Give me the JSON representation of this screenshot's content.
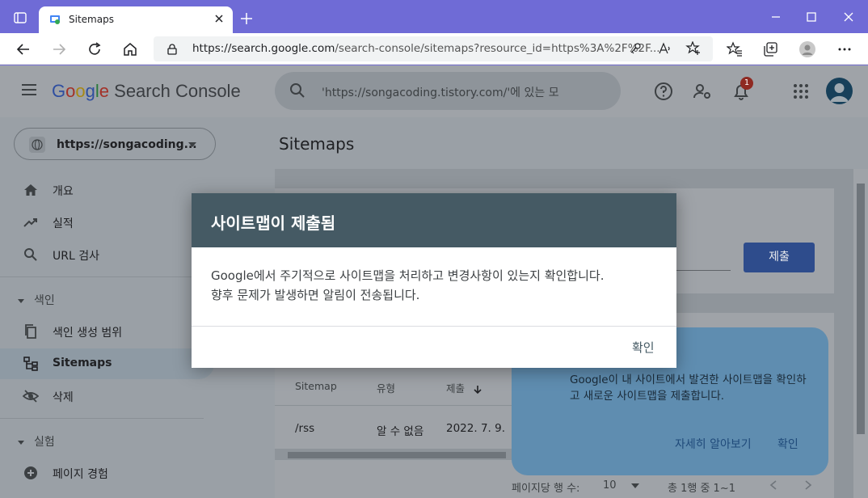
{
  "browser": {
    "tab_title": "Sitemaps",
    "url_host": "https://search.google.com",
    "url_rest": "/search-console/sitemaps?resource_id=https%3A%2F%2F..."
  },
  "header": {
    "logo_google": [
      "G",
      "o",
      "o",
      "g",
      "l",
      "e"
    ],
    "logo_product": "Search Console",
    "search_placeholder": "'https://songacoding.tistory.com/'에 있는 모",
    "notification_count": "1"
  },
  "sidebar": {
    "property": "https://songacoding...",
    "items": [
      {
        "label": "개요",
        "icon": "home-icon"
      },
      {
        "label": "실적",
        "icon": "trending-icon"
      },
      {
        "label": "URL 검사",
        "icon": "search-icon"
      }
    ],
    "section_index": "색인",
    "index_items": [
      {
        "label": "색인 생성 범위",
        "icon": "copy-icon"
      },
      {
        "label": "Sitemaps",
        "icon": "sitemap-icon"
      },
      {
        "label": "삭제",
        "icon": "eye-off-icon"
      }
    ],
    "section_experience": "실험",
    "experience_items": [
      {
        "label": "페이지 경험",
        "icon": "plus-circle-icon"
      }
    ]
  },
  "main": {
    "title": "Sitemaps",
    "submit_label": "제출",
    "table": {
      "headers": [
        "Sitemap",
        "유형",
        "제출"
      ],
      "rows": [
        [
          "/rss",
          "알 수 없음",
          "2022. 7. 9."
        ]
      ]
    },
    "pager": {
      "rows_per_page_label": "페이지당 행 수:",
      "rows_per_page": "10",
      "range": "총 1행 중 1~1"
    }
  },
  "tooltip": {
    "text": "Google이 내 사이트에서 발견한 사이트맵을 확인하고 새로운 사이트맵을 제출합니다.",
    "learn_more": "자세히 알아보기",
    "ok": "확인"
  },
  "dialog": {
    "title": "사이트맵이 제출됨",
    "body_line1": "Google에서 주기적으로 사이트맵을 처리하고 변경사항이 있는지 확인합니다.",
    "body_line2": "향후 문제가 발생하면 알림이 전송됩니다.",
    "ok": "확인"
  },
  "colors": {
    "dialog_header": "#455a64",
    "browser_frame": "#6f6bd6",
    "submit_button": "#1a73e8"
  }
}
